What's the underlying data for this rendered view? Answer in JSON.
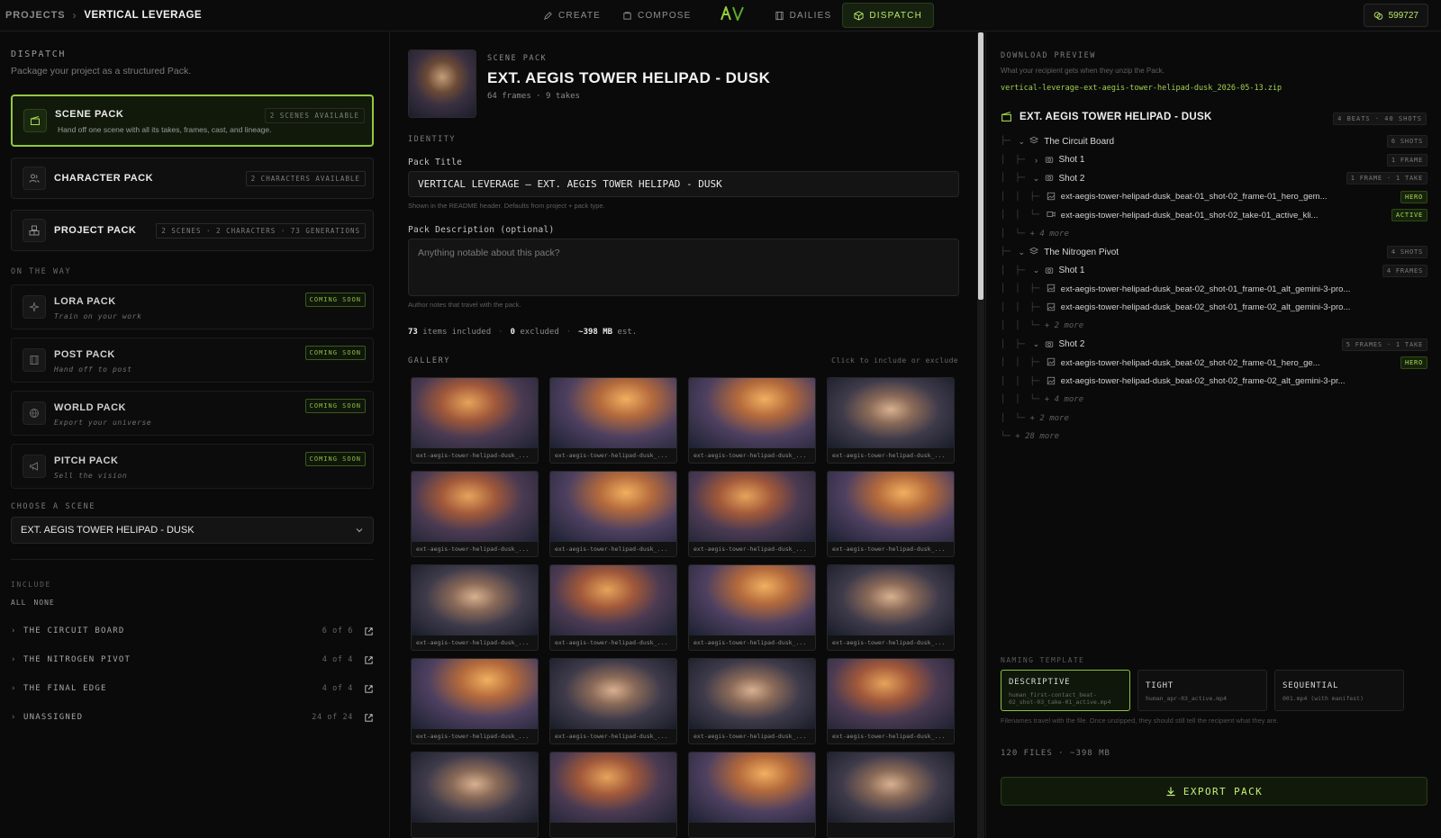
{
  "topbar": {
    "breadcrumb_root": "PROJECTS",
    "breadcrumb_sep": "›",
    "project_name": "VERTICAL LEVERAGE",
    "tabs": [
      {
        "label": "CREATE",
        "icon": "pen-icon"
      },
      {
        "label": "COMPOSE",
        "icon": "layers-icon"
      },
      {
        "label": "DAILIES",
        "icon": "film-icon"
      },
      {
        "label": "DISPATCH",
        "icon": "package-icon",
        "active": true
      }
    ],
    "credits": "599727"
  },
  "left": {
    "section_title": "DISPATCH",
    "section_sub": "Package your project as a structured Pack.",
    "packs": [
      {
        "title": "SCENE PACK",
        "desc": "Hand off one scene with all its takes, frames, cast, and lineage.",
        "badge": "2 SCENES AVAILABLE",
        "selected": true
      },
      {
        "title": "CHARACTER PACK",
        "badge": "2 CHARACTERS AVAILABLE"
      },
      {
        "title": "PROJECT PACK",
        "badge": "2 SCENES · 2 CHARACTERS · 73 GENERATIONS"
      }
    ],
    "on_the_way_label": "ON THE WAY",
    "upcoming": [
      {
        "title": "LORA PACK",
        "tag": "Train on your work",
        "soon": "COMING SOON"
      },
      {
        "title": "POST PACK",
        "tag": "Hand off to post",
        "soon": "COMING SOON"
      },
      {
        "title": "WORLD PACK",
        "tag": "Export your universe",
        "soon": "COMING SOON"
      },
      {
        "title": "PITCH PACK",
        "tag": "Sell the vision",
        "soon": "COMING SOON"
      }
    ],
    "choose_scene_label": "CHOOSE A SCENE",
    "scene_value": "EXT. AEGIS TOWER HELIPAD - DUSK",
    "include_label": "INCLUDE",
    "all_label": "ALL",
    "none_label": "NONE",
    "include_items": [
      {
        "label": "THE CIRCUIT BOARD",
        "count": "6 of 6"
      },
      {
        "label": "THE NITROGEN PIVOT",
        "count": "4 of 4"
      },
      {
        "label": "THE FINAL EDGE",
        "count": "4 of 4"
      },
      {
        "label": "UNASSIGNED",
        "count": "24 of 24"
      }
    ]
  },
  "mid": {
    "kicker": "SCENE PACK",
    "title": "EXT. AEGIS TOWER HELIPAD - DUSK",
    "meta": "64 frames · 9 takes",
    "identity_label": "IDENTITY",
    "pack_title_label": "Pack Title",
    "pack_title_value": "VERTICAL LEVERAGE — EXT. AEGIS TOWER HELIPAD - DUSK",
    "pack_title_hint": "Shown in the README header. Defaults from project + pack type.",
    "desc_label": "Pack Description (optional)",
    "desc_placeholder": "Anything notable about this pack?",
    "desc_hint": "Author notes that travel with the pack.",
    "stats": {
      "included": "73",
      "included_label": "items included",
      "excluded": "0",
      "excluded_label": "excluded",
      "size": "~398 MB",
      "size_label": "est."
    },
    "gallery_label": "GALLERY",
    "gallery_hint": "Click to include or exclude",
    "tile_caption": "ext-aegis-tower-helipad-dusk_..."
  },
  "right": {
    "kicker": "DOWNLOAD PREVIEW",
    "sub": "What your recipient gets when they unzip the Pack.",
    "zip_name": "vertical-leverage-ext-aegis-tower-helipad-dusk_2026-05-13.zip",
    "root_title": "EXT. AEGIS TOWER HELIPAD - DUSK",
    "root_badge": "4 BEATS · 40 SHOTS",
    "tree": [
      {
        "guide": "├─ ",
        "icon": "layers-icon",
        "chev": "⌄",
        "name": "The Circuit Board",
        "badge": "6 SHOTS"
      },
      {
        "guide": "│  ├─ ",
        "icon": "camera-icon",
        "chev": "›",
        "name": "Shot 1",
        "badge": "1 FRAME"
      },
      {
        "guide": "│  ├─ ",
        "icon": "camera-icon",
        "chev": "⌄",
        "name": "Shot 2",
        "badge": "1 FRAME · 1 TAKE"
      },
      {
        "guide": "│  │  ├─ ",
        "icon": "image-icon",
        "name": "ext-aegis-tower-helipad-dusk_beat-01_shot-02_frame-01_hero_gem...",
        "badge": "HERO",
        "file": true,
        "hero": true
      },
      {
        "guide": "│  │  └─ ",
        "icon": "video-icon",
        "name": "ext-aegis-tower-helipad-dusk_beat-01_shot-02_take-01_active_kli...",
        "badge": "ACTIVE",
        "file": true,
        "hero": true
      },
      {
        "guide": "│  └─ ",
        "more": "+ 4 more"
      },
      {
        "guide": "├─ ",
        "icon": "layers-icon",
        "chev": "⌄",
        "name": "The Nitrogen Pivot",
        "badge": "4 SHOTS"
      },
      {
        "guide": "│  ├─ ",
        "icon": "camera-icon",
        "chev": "⌄",
        "name": "Shot 1",
        "badge": "4 FRAMES"
      },
      {
        "guide": "│  │  ├─ ",
        "icon": "image-icon",
        "name": "ext-aegis-tower-helipad-dusk_beat-02_shot-01_frame-01_alt_gemini-3-pro...",
        "file": true
      },
      {
        "guide": "│  │  ├─ ",
        "icon": "image-icon",
        "name": "ext-aegis-tower-helipad-dusk_beat-02_shot-01_frame-02_alt_gemini-3-pro...",
        "file": true
      },
      {
        "guide": "│  │  └─ ",
        "more": "+ 2 more"
      },
      {
        "guide": "│  ├─ ",
        "icon": "camera-icon",
        "chev": "⌄",
        "name": "Shot 2",
        "badge": "5 FRAMES · 1 TAKE"
      },
      {
        "guide": "│  │  ├─ ",
        "icon": "image-icon",
        "name": "ext-aegis-tower-helipad-dusk_beat-02_shot-02_frame-01_hero_ge...",
        "badge": "HERO",
        "file": true,
        "hero": true
      },
      {
        "guide": "│  │  ├─ ",
        "icon": "image-icon",
        "name": "ext-aegis-tower-helipad-dusk_beat-02_shot-02_frame-02_alt_gemini-3-pr...",
        "file": true
      },
      {
        "guide": "│  │  └─ ",
        "more": "+ 4 more"
      },
      {
        "guide": "│  └─ ",
        "more": "+ 2 more"
      },
      {
        "guide": "└─ ",
        "more": "+ 28 more"
      }
    ],
    "naming_label": "NAMING TEMPLATE",
    "naming": [
      {
        "title": "DESCRIPTIVE",
        "desc": "human_first-contact_beat-02_shot-03_take-01_active.mp4",
        "selected": true
      },
      {
        "title": "TIGHT",
        "desc": "human_apr-03_active.mp4"
      },
      {
        "title": "SEQUENTIAL",
        "desc": "001.mp4 (with manifest)"
      }
    ],
    "naming_hint": "Filenames travel with the file. Once unzipped, they should still tell the recipient what they are.",
    "files_count": "120 FILES · ~398 MB",
    "export_label": "EXPORT PACK"
  }
}
